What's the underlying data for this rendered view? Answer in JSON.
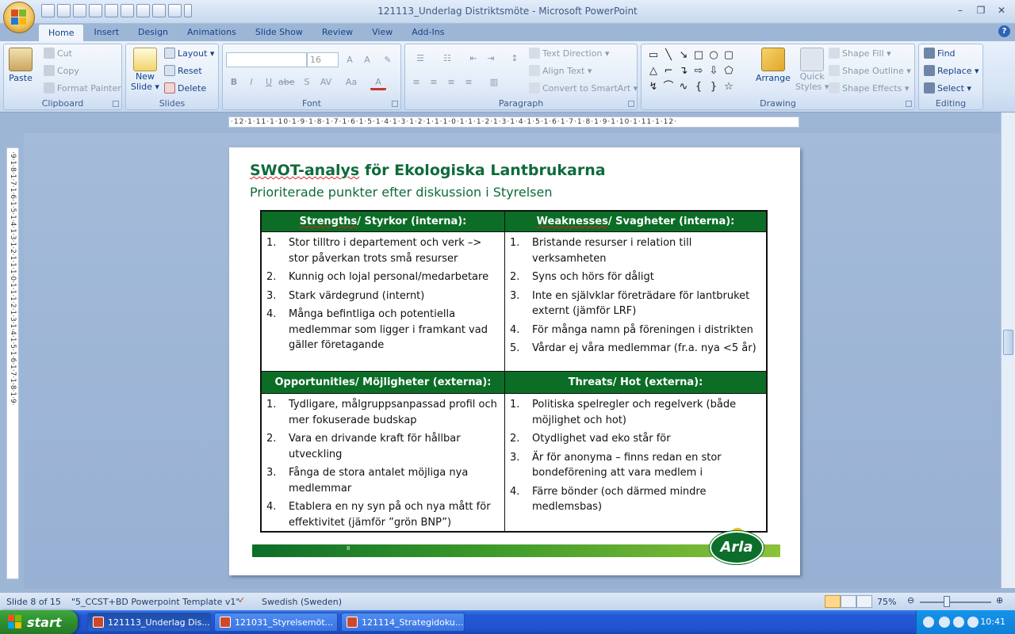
{
  "window": {
    "title": "121113_Underlag Distriktsmöte - Microsoft PowerPoint",
    "controls": [
      "–",
      "❐",
      "✕"
    ]
  },
  "tabs": [
    "Home",
    "Insert",
    "Design",
    "Animations",
    "Slide Show",
    "Review",
    "View",
    "Add-Ins"
  ],
  "active_tab": "Home",
  "ribbon": {
    "clipboard": {
      "paste": "Paste",
      "cut": "Cut",
      "copy": "Copy",
      "format_painter": "Format Painter",
      "label": "Clipboard"
    },
    "slides": {
      "new_slide": "New",
      "new_slide2": "Slide ▾",
      "layout": "Layout ▾",
      "reset": "Reset",
      "delete": "Delete",
      "label": "Slides"
    },
    "font": {
      "font_size": "16",
      "label": "Font"
    },
    "paragraph": {
      "text_direction": "Text Direction ▾",
      "align_text": "Align Text ▾",
      "convert_smartart": "Convert to SmartArt ▾",
      "label": "Paragraph"
    },
    "drawing": {
      "arrange": "Arrange",
      "quick_styles": "Quick",
      "quick_styles2": "Styles ▾",
      "shape_fill": "Shape Fill ▾",
      "shape_outline": "Shape Outline ▾",
      "shape_effects": "Shape Effects ▾",
      "label": "Drawing"
    },
    "editing": {
      "find": "Find",
      "replace": "Replace ▾",
      "select": "Select ▾",
      "label": "Editing"
    }
  },
  "ruler_h": "·12·1·11·1·10·1·9·1·8·1·7·1·6·1·5·1·4·1·3·1·2·1·1·1·0·1·1·1·2·1·3·1·4·1·5·1·6·1·7·1·8·1·9·1·10·1·11·1·12·",
  "ruler_v": "·9·1·8·1·7·1·6·1·5·1·4·1·3·1·2·1·1·1·0·1·1·1·2·1·3·1·4·1·5·1·6·1·7·1·8·1·9·",
  "slide": {
    "title_main": "SWOT-analys",
    "title_rest": " för Ekologiska Lantbrukarna",
    "subtitle": "Prioriterade punkter efter diskussion i Styrelsen",
    "page_num": "8",
    "logo": "Arla",
    "swot": {
      "strengths": {
        "header_a": "Strengths",
        "header_b": "/ Styrkor (interna):",
        "items": [
          "Stor tilltro i departement och verk –> stor påverkan trots små resurser",
          "Kunnig och lojal personal/medarbetare",
          "Stark värdegrund (internt)",
          "Många befintliga och potentiella medlemmar som ligger i framkant vad gäller företagande"
        ]
      },
      "weaknesses": {
        "header_a": "Weaknesses",
        "header_b": "/ Svagheter (interna):",
        "items": [
          "Bristande resurser i relation till verksamheten",
          "Syns och hörs för dåligt",
          "Inte en självklar företrädare för lantbruket externt (jämför LRF)",
          "För många namn på föreningen i distrikten",
          "Vårdar ej våra medlemmar (fr.a. nya <5 år)"
        ]
      },
      "opportunities": {
        "header": "Opportunities/ Möjligheter (externa):",
        "items": [
          "Tydligare, målgruppsanpassad profil och mer fokuserade budskap",
          "Vara en drivande kraft för hållbar utveckling",
          "Fånga de stora antalet möjliga nya medlemmar",
          "Etablera en ny syn på och nya mått för effektivitet (jämför ”grön BNP”)"
        ]
      },
      "threats": {
        "header": "Threats/ Hot (externa):",
        "items": [
          "Politiska spelregler och regelverk (både möjlighet och hot)",
          "Otydlighet vad eko står för",
          "Är för anonyma – finns redan en stor bondeförening att vara medlem i",
          "Färre bönder (och därmed mindre medlemsbas)"
        ]
      }
    }
  },
  "status": {
    "slide": "Slide 8 of 15",
    "template": "\"5_CCST+BD Powerpoint Template v1\"",
    "language": "Swedish (Sweden)",
    "zoom": "75%"
  },
  "taskbar": {
    "start": "start",
    "tasks": [
      "121113_Underlag Dis...",
      "121031_Styrelsemöt...",
      "121114_Strategidoku..."
    ],
    "clock": "10:41"
  }
}
